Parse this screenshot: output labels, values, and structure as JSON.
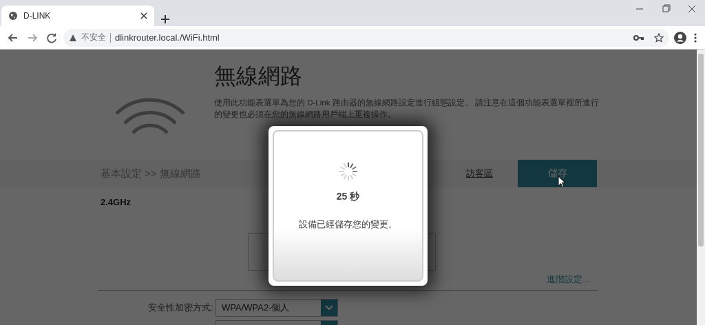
{
  "browser": {
    "tab": {
      "title": "D-LINK"
    },
    "address": {
      "security": "不安全",
      "url": "dlinkrouter.local./WiFi.html"
    }
  },
  "page": {
    "title": "無線網路",
    "description": "使用此功能表選單為您的 D-Link 路由器的無線網路設定進行組態設定。 請注意在這個功能表選單裡所進行的變更也必須在您的無線網路用戶端上重複操作。",
    "breadcrumb": "基本設定 >> 無線網路",
    "guest_link": "訪客區",
    "save_button": "儲存",
    "band": "2.4GHz",
    "advanced_link": "進階設定...",
    "security": {
      "label": "安全性加密方式:",
      "value": "WPA/WPA2-個人"
    }
  },
  "dialog": {
    "countdown": "25 秒",
    "message": "設備已經儲存您的變更。"
  }
}
